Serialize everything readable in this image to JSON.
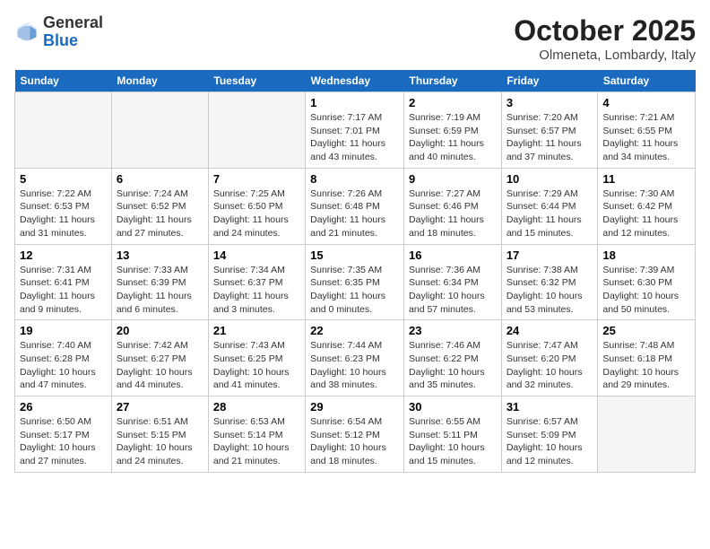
{
  "header": {
    "logo_general": "General",
    "logo_blue": "Blue",
    "month": "October 2025",
    "location": "Olmeneta, Lombardy, Italy"
  },
  "weekdays": [
    "Sunday",
    "Monday",
    "Tuesday",
    "Wednesday",
    "Thursday",
    "Friday",
    "Saturday"
  ],
  "weeks": [
    [
      {
        "day": "",
        "detail": ""
      },
      {
        "day": "",
        "detail": ""
      },
      {
        "day": "",
        "detail": ""
      },
      {
        "day": "1",
        "detail": "Sunrise: 7:17 AM\nSunset: 7:01 PM\nDaylight: 11 hours and 43 minutes."
      },
      {
        "day": "2",
        "detail": "Sunrise: 7:19 AM\nSunset: 6:59 PM\nDaylight: 11 hours and 40 minutes."
      },
      {
        "day": "3",
        "detail": "Sunrise: 7:20 AM\nSunset: 6:57 PM\nDaylight: 11 hours and 37 minutes."
      },
      {
        "day": "4",
        "detail": "Sunrise: 7:21 AM\nSunset: 6:55 PM\nDaylight: 11 hours and 34 minutes."
      }
    ],
    [
      {
        "day": "5",
        "detail": "Sunrise: 7:22 AM\nSunset: 6:53 PM\nDaylight: 11 hours and 31 minutes."
      },
      {
        "day": "6",
        "detail": "Sunrise: 7:24 AM\nSunset: 6:52 PM\nDaylight: 11 hours and 27 minutes."
      },
      {
        "day": "7",
        "detail": "Sunrise: 7:25 AM\nSunset: 6:50 PM\nDaylight: 11 hours and 24 minutes."
      },
      {
        "day": "8",
        "detail": "Sunrise: 7:26 AM\nSunset: 6:48 PM\nDaylight: 11 hours and 21 minutes."
      },
      {
        "day": "9",
        "detail": "Sunrise: 7:27 AM\nSunset: 6:46 PM\nDaylight: 11 hours and 18 minutes."
      },
      {
        "day": "10",
        "detail": "Sunrise: 7:29 AM\nSunset: 6:44 PM\nDaylight: 11 hours and 15 minutes."
      },
      {
        "day": "11",
        "detail": "Sunrise: 7:30 AM\nSunset: 6:42 PM\nDaylight: 11 hours and 12 minutes."
      }
    ],
    [
      {
        "day": "12",
        "detail": "Sunrise: 7:31 AM\nSunset: 6:41 PM\nDaylight: 11 hours and 9 minutes."
      },
      {
        "day": "13",
        "detail": "Sunrise: 7:33 AM\nSunset: 6:39 PM\nDaylight: 11 hours and 6 minutes."
      },
      {
        "day": "14",
        "detail": "Sunrise: 7:34 AM\nSunset: 6:37 PM\nDaylight: 11 hours and 3 minutes."
      },
      {
        "day": "15",
        "detail": "Sunrise: 7:35 AM\nSunset: 6:35 PM\nDaylight: 11 hours and 0 minutes."
      },
      {
        "day": "16",
        "detail": "Sunrise: 7:36 AM\nSunset: 6:34 PM\nDaylight: 10 hours and 57 minutes."
      },
      {
        "day": "17",
        "detail": "Sunrise: 7:38 AM\nSunset: 6:32 PM\nDaylight: 10 hours and 53 minutes."
      },
      {
        "day": "18",
        "detail": "Sunrise: 7:39 AM\nSunset: 6:30 PM\nDaylight: 10 hours and 50 minutes."
      }
    ],
    [
      {
        "day": "19",
        "detail": "Sunrise: 7:40 AM\nSunset: 6:28 PM\nDaylight: 10 hours and 47 minutes."
      },
      {
        "day": "20",
        "detail": "Sunrise: 7:42 AM\nSunset: 6:27 PM\nDaylight: 10 hours and 44 minutes."
      },
      {
        "day": "21",
        "detail": "Sunrise: 7:43 AM\nSunset: 6:25 PM\nDaylight: 10 hours and 41 minutes."
      },
      {
        "day": "22",
        "detail": "Sunrise: 7:44 AM\nSunset: 6:23 PM\nDaylight: 10 hours and 38 minutes."
      },
      {
        "day": "23",
        "detail": "Sunrise: 7:46 AM\nSunset: 6:22 PM\nDaylight: 10 hours and 35 minutes."
      },
      {
        "day": "24",
        "detail": "Sunrise: 7:47 AM\nSunset: 6:20 PM\nDaylight: 10 hours and 32 minutes."
      },
      {
        "day": "25",
        "detail": "Sunrise: 7:48 AM\nSunset: 6:18 PM\nDaylight: 10 hours and 29 minutes."
      }
    ],
    [
      {
        "day": "26",
        "detail": "Sunrise: 6:50 AM\nSunset: 5:17 PM\nDaylight: 10 hours and 27 minutes."
      },
      {
        "day": "27",
        "detail": "Sunrise: 6:51 AM\nSunset: 5:15 PM\nDaylight: 10 hours and 24 minutes."
      },
      {
        "day": "28",
        "detail": "Sunrise: 6:53 AM\nSunset: 5:14 PM\nDaylight: 10 hours and 21 minutes."
      },
      {
        "day": "29",
        "detail": "Sunrise: 6:54 AM\nSunset: 5:12 PM\nDaylight: 10 hours and 18 minutes."
      },
      {
        "day": "30",
        "detail": "Sunrise: 6:55 AM\nSunset: 5:11 PM\nDaylight: 10 hours and 15 minutes."
      },
      {
        "day": "31",
        "detail": "Sunrise: 6:57 AM\nSunset: 5:09 PM\nDaylight: 10 hours and 12 minutes."
      },
      {
        "day": "",
        "detail": ""
      }
    ]
  ]
}
